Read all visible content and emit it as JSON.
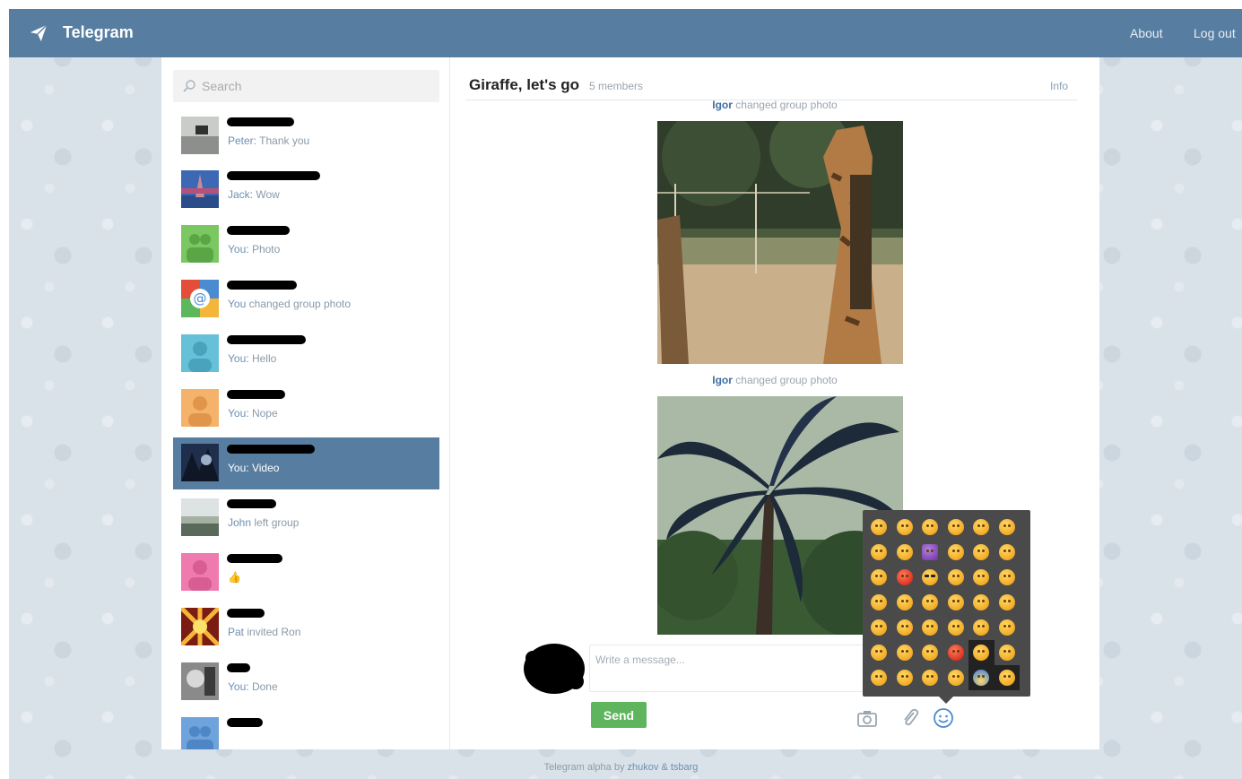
{
  "header": {
    "app_title": "Telegram",
    "about_label": "About",
    "logout_label": "Log out",
    "bar_color": "#577ea1"
  },
  "sidebar": {
    "search": {
      "placeholder": "Search",
      "value": ""
    },
    "dialogs": [
      {
        "sender": "Peter:",
        "message": "Thank you",
        "avatar": "photo-desk",
        "active": false
      },
      {
        "sender": "Jack:",
        "message": "Wow",
        "avatar": "photo-eiffel",
        "active": false
      },
      {
        "sender": "You:",
        "message": "Photo",
        "avatar": "placeholder-green-group",
        "active": false
      },
      {
        "sender": "You",
        "message": "changed group photo",
        "avatar": "mail-at-icon",
        "active": false
      },
      {
        "sender": "You:",
        "message": "Hello",
        "avatar": "placeholder-teal-user",
        "active": false
      },
      {
        "sender": "You:",
        "message": "Nope",
        "avatar": "placeholder-orange-user",
        "active": false
      },
      {
        "sender": "You:",
        "message": "Video",
        "avatar": "photo-dark",
        "active": true
      },
      {
        "sender": "John",
        "message": "left group",
        "avatar": "photo-landscape",
        "active": false
      },
      {
        "sender": "",
        "message": "👍",
        "avatar": "placeholder-pink-user",
        "active": false
      },
      {
        "sender": "Pat",
        "message": "invited Ron",
        "avatar": "photo-sunset",
        "active": false
      },
      {
        "sender": "You:",
        "message": "Done",
        "avatar": "photo-bw",
        "active": false
      },
      {
        "sender": "",
        "message": "",
        "avatar": "placeholder-blue-group",
        "active": false
      }
    ]
  },
  "chat": {
    "title": "Giraffe, let's go",
    "members": "5 members",
    "info_label": "Info",
    "service_messages": [
      {
        "actor": "Igor",
        "text": "changed group photo"
      },
      {
        "actor": "Igor",
        "text": "changed group photo"
      }
    ],
    "photos": [
      "giraffe-photo",
      "palm-tree-photo"
    ]
  },
  "composer": {
    "placeholder": "Write a message...",
    "value": "",
    "send_label": "Send",
    "send_color": "#5fb55d",
    "icons": [
      "camera-icon",
      "attach-icon",
      "emoji-icon"
    ]
  },
  "emoji_panel": {
    "rows": 7,
    "cols": 6,
    "special": {
      "1-2": "devil",
      "2-1": "angry",
      "2-2": "cool",
      "5-3": "angry",
      "6-4": "cold"
    },
    "selected": [
      "5-4",
      "6-4",
      "6-5"
    ]
  },
  "footer": {
    "text": "Telegram alpha by",
    "link": "zhukov & tsbarg"
  }
}
